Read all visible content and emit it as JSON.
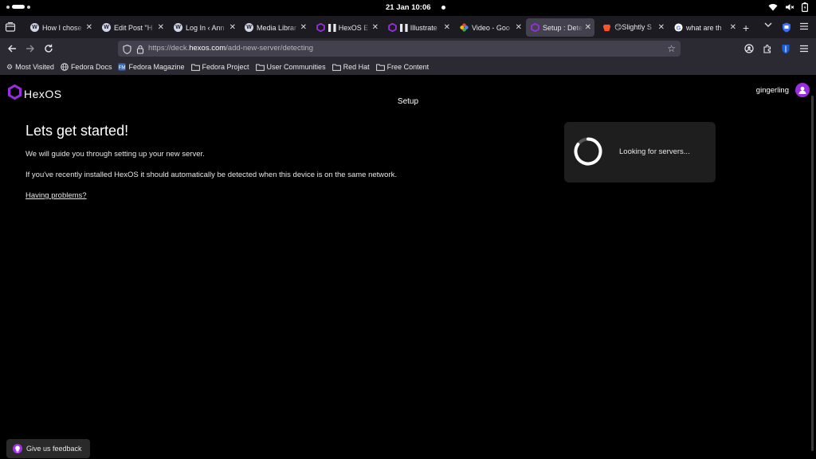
{
  "system": {
    "clock": "21 Jan  10:06"
  },
  "tabs": [
    {
      "title": "How I chose",
      "favicon": "wordpress-icon"
    },
    {
      "title": "Edit Post \"H",
      "favicon": "wordpress-icon"
    },
    {
      "title": "Log In ‹ Ann",
      "favicon": "wordpress-icon"
    },
    {
      "title": "Media Librar",
      "favicon": "wordpress-icon"
    },
    {
      "title": "▌▌HexOS E",
      "favicon": "hexos-icon"
    },
    {
      "title": "▌▌Illustrate",
      "favicon": "hexos-icon"
    },
    {
      "title": "Video - Goo",
      "favicon": "google-photos-icon"
    },
    {
      "title": "Setup : Dete",
      "favicon": "hexos-icon",
      "active": true
    },
    {
      "title": "😏Slightly S",
      "favicon": "brave-icon"
    },
    {
      "title": "what are th",
      "favicon": "google-icon"
    }
  ],
  "urlbar": {
    "prefix": "https://deck.",
    "domain": "hexos.com",
    "path": "/add-new-server/detecting"
  },
  "bookmarks": [
    {
      "label": "Most Visited",
      "icon": "gear-icon"
    },
    {
      "label": "Fedora Docs",
      "icon": "globe-icon"
    },
    {
      "label": "Fedora Magazine",
      "icon": "fedora-magazine-icon"
    },
    {
      "label": "Fedora Project",
      "icon": "folder-icon"
    },
    {
      "label": "User Communities",
      "icon": "folder-icon"
    },
    {
      "label": "Red Hat",
      "icon": "folder-icon"
    },
    {
      "label": "Free Content",
      "icon": "folder-icon"
    }
  ],
  "app": {
    "logo_text_a": "Hex",
    "logo_text_b": "OS",
    "page_title": "Setup",
    "username": "gingerling",
    "brand_color": "#9b2ce0"
  },
  "content": {
    "heading": "Lets get started!",
    "line1": "We will guide you through setting up your new server.",
    "line2": "If you've recently installed HexOS it should automatically be detected when this device is on the same network.",
    "help_link": "Having problems?"
  },
  "detect_card": {
    "status": "Looking for servers..."
  },
  "feedback": {
    "label": "Give us feedback"
  }
}
